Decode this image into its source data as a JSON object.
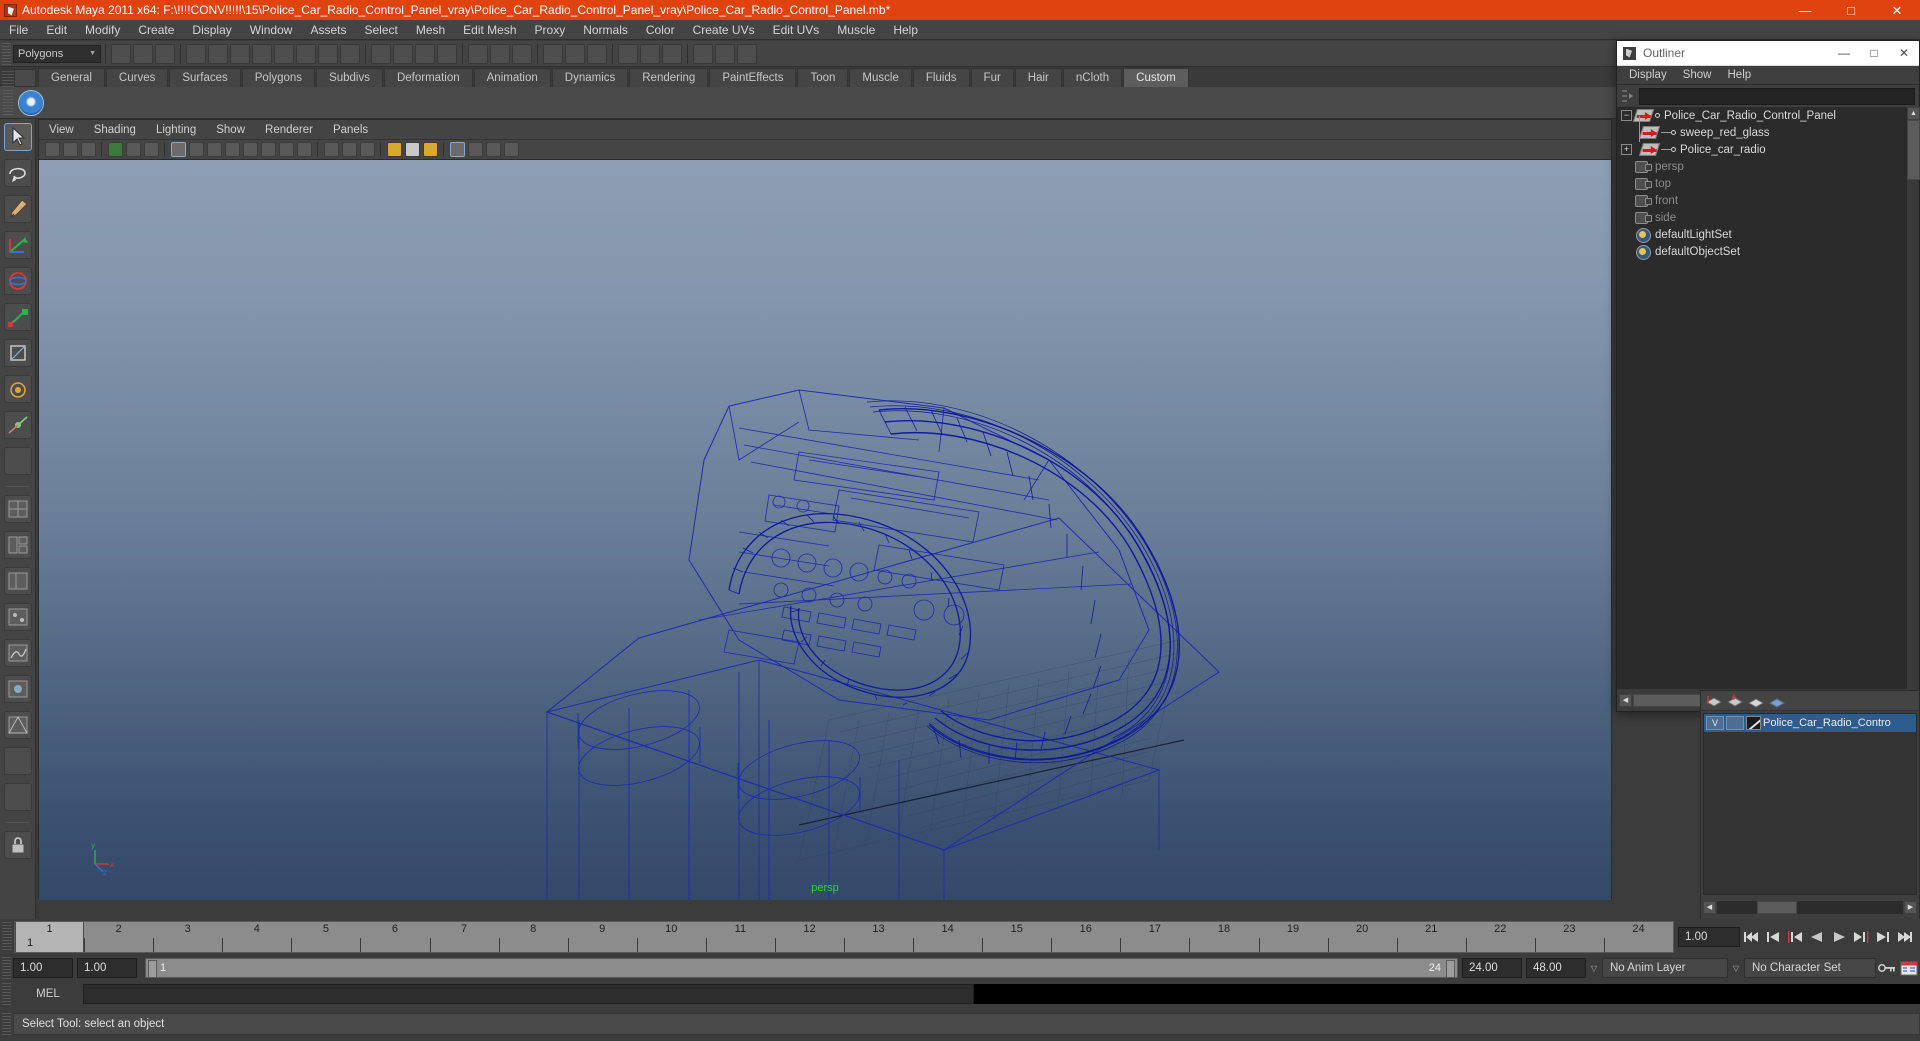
{
  "window": {
    "title": "Autodesk Maya 2011 x64: F:\\!!!!CONV!!!!!\\15\\Police_Car_Radio_Control_Panel_vray\\Police_Car_Radio_Control_Panel_vray\\Police_Car_Radio_Control_Panel.mb*",
    "accent_color": "#e04310",
    "minimize": "—",
    "maximize": "□",
    "close": "✕"
  },
  "menubar": {
    "items": [
      "File",
      "Edit",
      "Modify",
      "Create",
      "Display",
      "Window",
      "Assets",
      "Select",
      "Mesh",
      "Edit Mesh",
      "Proxy",
      "Normals",
      "Color",
      "Create UVs",
      "Edit UVs",
      "Muscle",
      "Help"
    ]
  },
  "statusbar": {
    "mode_selector": "Polygons"
  },
  "shelf": {
    "tabs": [
      "General",
      "Curves",
      "Surfaces",
      "Polygons",
      "Subdivs",
      "Deformation",
      "Animation",
      "Dynamics",
      "Rendering",
      "PaintEffects",
      "Toon",
      "Muscle",
      "Fluids",
      "Fur",
      "Hair",
      "nCloth",
      "Custom"
    ],
    "active_tab": "Custom"
  },
  "viewport": {
    "menus": [
      "View",
      "Shading",
      "Lighting",
      "Show",
      "Renderer",
      "Panels"
    ],
    "camera_label": "persp",
    "camera_label_color": "#2fd62f",
    "wireframe_color": "#1c28b4",
    "axis_labels": [
      "x",
      "y",
      "z"
    ]
  },
  "outliner": {
    "title": "Outliner",
    "menus": [
      "Display",
      "Show",
      "Help"
    ],
    "search_value": "",
    "items": [
      {
        "label": "Police_Car_Radio_Control_Panel",
        "icon": "transform-icon",
        "expander": "−",
        "depth": 0,
        "dim": false
      },
      {
        "label": "sweep_red_glass",
        "icon": "transform-icon",
        "expander": "",
        "depth": 1,
        "dim": false
      },
      {
        "label": "Police_car_radio",
        "icon": "transform-icon",
        "expander": "+",
        "depth": 1,
        "dim": false
      },
      {
        "label": "persp",
        "icon": "camera-icon",
        "expander": "",
        "depth": 0,
        "dim": true
      },
      {
        "label": "top",
        "icon": "camera-icon",
        "expander": "",
        "depth": 0,
        "dim": true
      },
      {
        "label": "front",
        "icon": "camera-icon",
        "expander": "",
        "depth": 0,
        "dim": true
      },
      {
        "label": "side",
        "icon": "camera-icon",
        "expander": "",
        "depth": 0,
        "dim": true
      },
      {
        "label": "defaultLightSet",
        "icon": "set-icon",
        "expander": "",
        "depth": 0,
        "dim": false
      },
      {
        "label": "defaultObjectSet",
        "icon": "set-icon",
        "expander": "",
        "depth": 0,
        "dim": false
      }
    ]
  },
  "layer_editor": {
    "rows": [
      {
        "visibility": "V",
        "playback": "",
        "color_swatch": "layer-color-swatch",
        "name": "Police_Car_Radio_Contro"
      }
    ]
  },
  "timeslider": {
    "current_frame": "1",
    "ticks": [
      "1",
      "2",
      "3",
      "4",
      "5",
      "6",
      "7",
      "8",
      "9",
      "10",
      "11",
      "12",
      "13",
      "14",
      "15",
      "16",
      "17",
      "18",
      "19",
      "20",
      "21",
      "22",
      "23",
      "24"
    ],
    "current_time_field": "1.00",
    "transport": [
      "go-to-start-button",
      "step-back-keyframe-button",
      "step-back-frame-button",
      "play-backwards-button",
      "play-forwards-button",
      "step-forward-frame-button",
      "step-forward-keyframe-button",
      "go-to-end-button"
    ]
  },
  "rangeslider": {
    "anim_start": "1.00",
    "anim_end": "1.00",
    "range_start": "1",
    "range_end": "24",
    "playback_end": "24.00",
    "anim_end_total": "48.00",
    "anim_layer": "No Anim Layer",
    "character_set": "No Character Set"
  },
  "command": {
    "label": "MEL",
    "value": "",
    "placeholder": ""
  },
  "helpline": {
    "text": "Select Tool: select an object"
  }
}
